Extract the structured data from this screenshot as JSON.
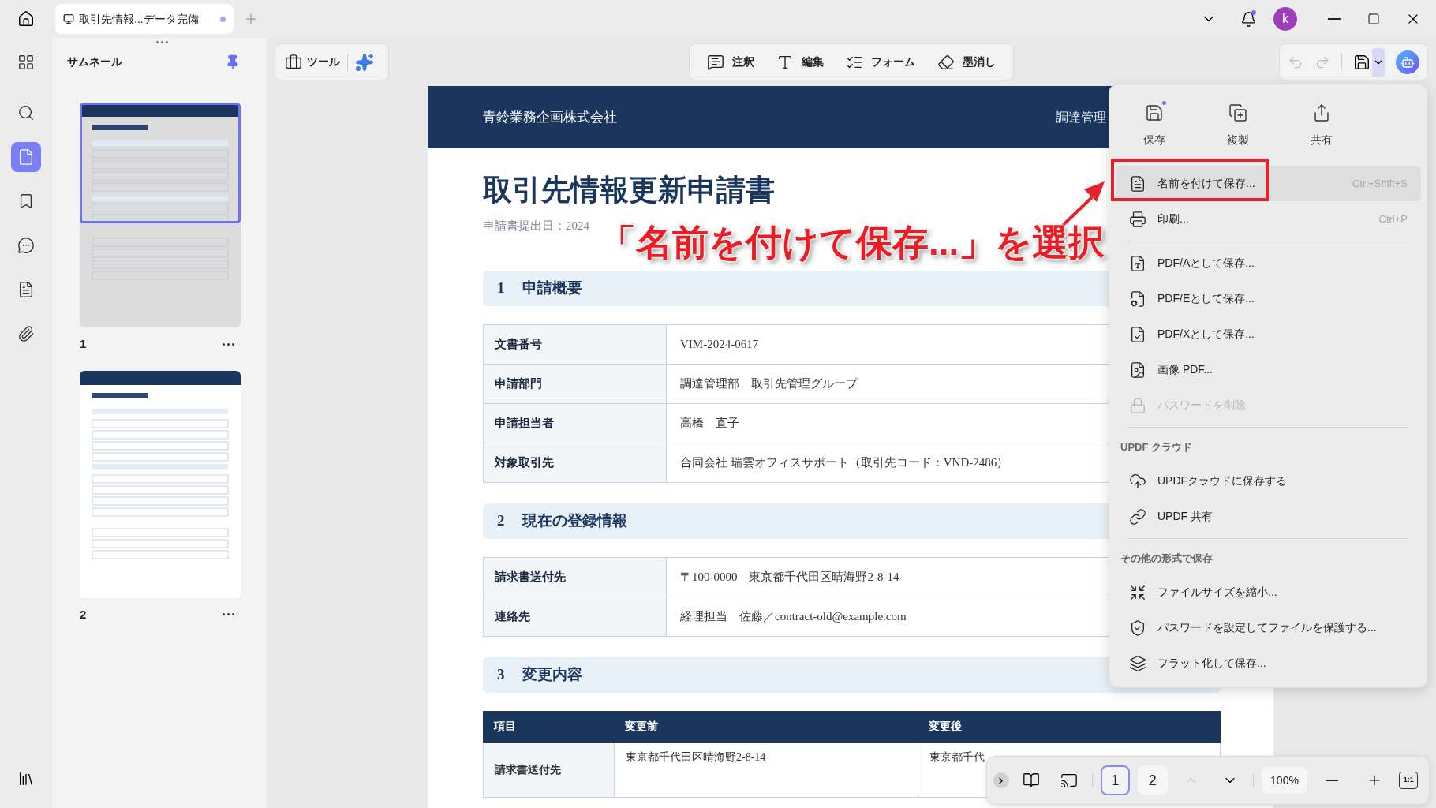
{
  "title_bar": {
    "tab": {
      "title": "取引先情報...データ完備",
      "modified": true
    },
    "bell": {
      "unread": true
    },
    "account": {
      "initial": "k"
    }
  },
  "rail": [
    {
      "kind": "apps",
      "selected": false
    },
    {
      "kind": "search",
      "selected": false
    },
    {
      "kind": "pages",
      "selected": true
    },
    {
      "kind": "bookmarks",
      "selected": false
    },
    {
      "kind": "comments",
      "selected": false
    },
    {
      "kind": "forms",
      "selected": false
    },
    {
      "kind": "attachments",
      "selected": false
    }
  ],
  "thumbnails": {
    "title": "サムネール",
    "pinned": true,
    "pages": [
      {
        "number": "1",
        "kind": "form",
        "selected": true
      },
      {
        "number": "2",
        "kind": "record",
        "selected": false
      }
    ]
  },
  "toolbar": {
    "tools_label": "ツール",
    "modes": [
      {
        "kind": "comment",
        "label": "注釈"
      },
      {
        "kind": "edit",
        "label": "編集"
      },
      {
        "kind": "form",
        "label": "フォーム"
      },
      {
        "kind": "redact",
        "label": "墨消し"
      }
    ],
    "undo_enabled": false,
    "redo_enabled": false
  },
  "document": {
    "company": "青鈴業務企画株式会社",
    "department": "調達管理",
    "title": "取引先情報更新申請書",
    "date": "申請書提出日：2024",
    "sections": [
      {
        "number": "1",
        "title": "申請概要",
        "kind": "pairs",
        "rows": [
          {
            "label": "文書番号",
            "value": "VIM-2024-0617"
          },
          {
            "label": "申請部門",
            "value": "調達管理部　取引先管理グループ"
          },
          {
            "label": "申請担当者",
            "value": "高橋　直子"
          },
          {
            "label": "対象取引先",
            "value": "合同会社 瑞雲オフィスサポート（取引先コード：VND-2486）"
          }
        ]
      },
      {
        "number": "2",
        "title": "現在の登録情報",
        "kind": "pairs",
        "rows": [
          {
            "label": "請求書送付先",
            "value": "〒100-0000　東京都千代田区晴海野2-8-14"
          },
          {
            "label": "連絡先",
            "value": "経理担当　佐藤／contract-old@example.com"
          }
        ]
      },
      {
        "number": "3",
        "title": "変更内容",
        "kind": "grid",
        "columns": [
          "項目",
          "変更前",
          "変更後"
        ],
        "rows": [
          [
            "請求書送付先",
            "東京都千代田区晴海野2-8-14",
            "東京都千代"
          ]
        ]
      }
    ]
  },
  "menu": {
    "actions": [
      {
        "kind": "save",
        "label": "保存",
        "badge": true
      },
      {
        "kind": "duplicate",
        "label": "複製",
        "badge": false
      },
      {
        "kind": "share",
        "label": "共有",
        "badge": false
      }
    ],
    "items": [
      {
        "kind": "save-as",
        "label": "名前を付けて保存...",
        "shortcut": "Ctrl+Shift+S",
        "selected": true,
        "disabled": false
      },
      {
        "kind": "print",
        "label": "印刷...",
        "shortcut": "Ctrl+P",
        "selected": false,
        "disabled": false
      },
      {
        "kind": "divider"
      },
      {
        "kind": "pdfa",
        "label": "PDF/Aとして保存...",
        "selected": false,
        "disabled": false
      },
      {
        "kind": "pdfe",
        "label": "PDF/Eとして保存...",
        "selected": false,
        "disabled": false
      },
      {
        "kind": "pdfx",
        "label": "PDF/Xとして保存...",
        "selected": false,
        "disabled": false
      },
      {
        "kind": "image",
        "label": "画像 PDF...",
        "selected": false,
        "disabled": false
      },
      {
        "kind": "unlock",
        "label": "パスワードを削除",
        "selected": false,
        "disabled": true
      },
      {
        "kind": "divider"
      },
      {
        "kind": "heading",
        "label": "UPDF クラウド"
      },
      {
        "kind": "cloud",
        "label": "UPDFクラウドに保存する",
        "selected": false,
        "disabled": false
      },
      {
        "kind": "link",
        "label": "UPDF 共有",
        "selected": false,
        "disabled": false
      },
      {
        "kind": "divider"
      },
      {
        "kind": "heading",
        "label": "その他の形式で保存"
      },
      {
        "kind": "compress",
        "label": "ファイルサイズを縮小...",
        "selected": false,
        "disabled": false
      },
      {
        "kind": "protect",
        "label": "パスワードを設定してファイルを保護する...",
        "selected": false,
        "disabled": false
      },
      {
        "kind": "flatten",
        "label": "フラット化して保存...",
        "selected": false,
        "disabled": false
      }
    ]
  },
  "page_nav": {
    "pages": [
      {
        "label": "1",
        "selected": true
      },
      {
        "label": "2",
        "selected": false
      }
    ],
    "prev_enabled": false,
    "zoom": "100%",
    "actual_size": "1:1"
  },
  "annotation": {
    "text": "「名前を付けて保存...」を選択"
  }
}
